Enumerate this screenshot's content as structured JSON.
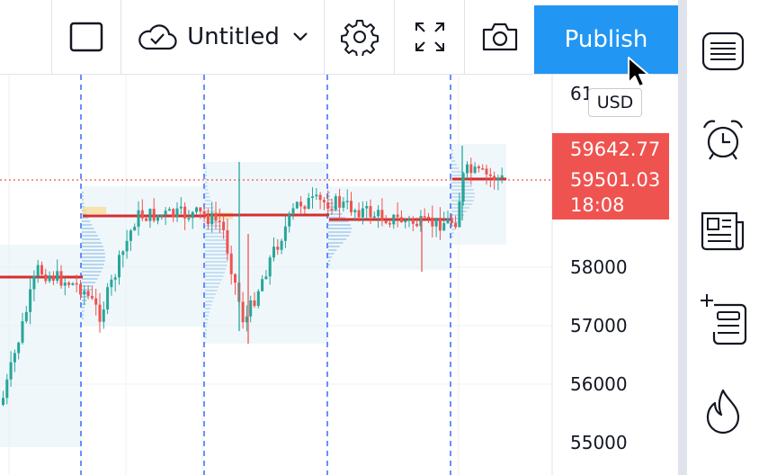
{
  "toolbar": {
    "layout_icon": "square-icon",
    "save_icon": "cloud-check-icon",
    "chart_name": "Untitled",
    "dropdown_icon": "chevron-down-icon",
    "settings_icon": "gear-icon",
    "fullscreen_icon": "fullscreen-icon",
    "snapshot_icon": "camera-icon",
    "publish_label": "Publish",
    "publish_color": "#2196f3"
  },
  "price_scale": {
    "currency": "USD",
    "top_partial_label": "61",
    "labels": [
      "58000",
      "57000",
      "56000",
      "55000"
    ]
  },
  "price_tags": {
    "upper_price": "59642.77",
    "last_price": "59501.03",
    "countdown": "18:08",
    "tag_color": "#ef5350"
  },
  "colors": {
    "up_candle": "#26a69a",
    "down_candle": "#ef5350",
    "session_line": "#2962ff",
    "poc_line": "#d32f2f"
  },
  "right_toolbar": {
    "items": [
      {
        "icon": "watchlist-icon"
      },
      {
        "icon": "alarm-clock-icon"
      },
      {
        "icon": "news-icon"
      },
      {
        "icon": "data-window-icon"
      },
      {
        "icon": "hotlist-fire-icon"
      }
    ]
  }
}
